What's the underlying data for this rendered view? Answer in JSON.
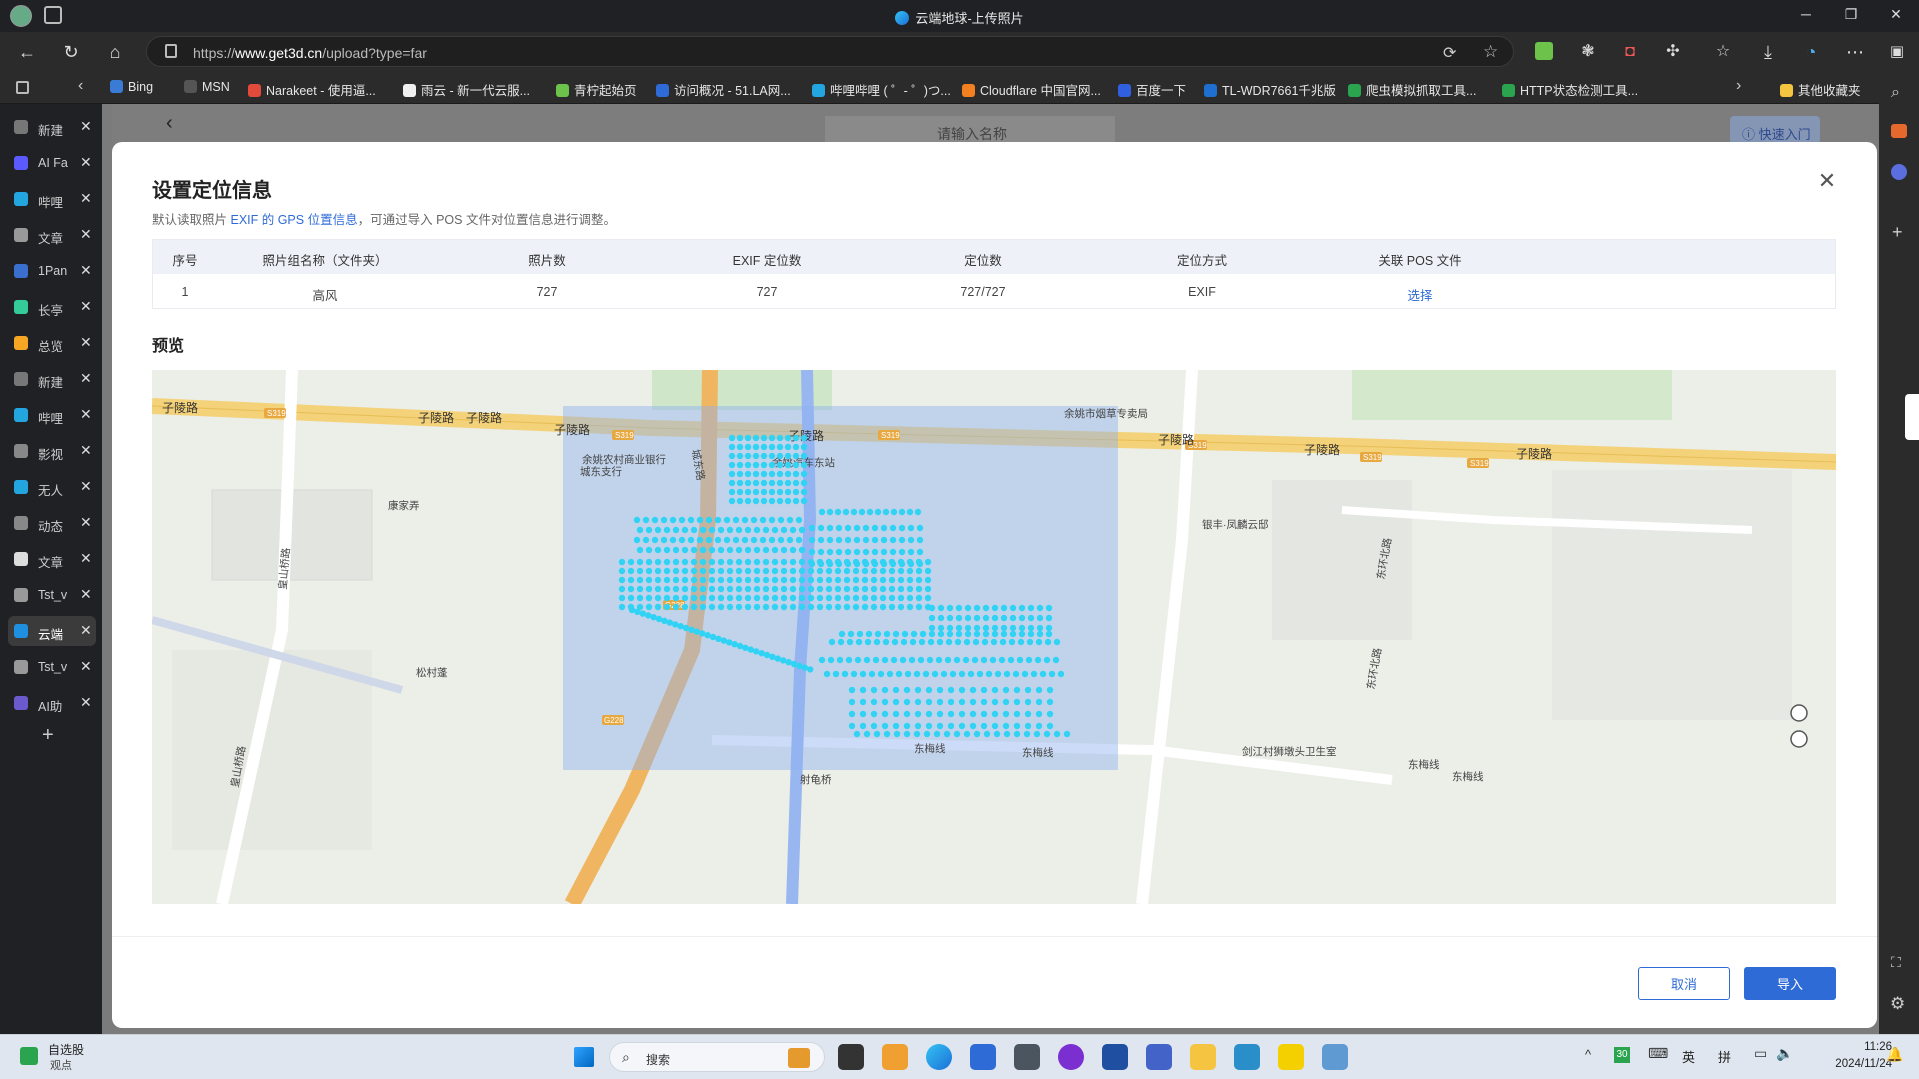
{
  "window": {
    "title": "云端地球-上传照片"
  },
  "address_bar": {
    "url_prefix": "https://",
    "url_host": "www.get3d.cn",
    "url_path": "/upload?type=far"
  },
  "bookmarks": [
    {
      "label": "Bing",
      "color": "#3a7bd5"
    },
    {
      "label": "MSN",
      "color": "#555"
    },
    {
      "label": "Narakeet - 使用逼...",
      "color": "#e24a3b"
    },
    {
      "label": "雨云 - 新一代云服...",
      "color": "#f0f0f0"
    },
    {
      "label": "青柠起始页",
      "color": "#6cc24a"
    },
    {
      "label": "访问概况 - 51.LA网...",
      "color": "#2f6bd6"
    },
    {
      "label": "哔哩哔哩 ( ゜- ゜)つ...",
      "color": "#23a6e0"
    },
    {
      "label": "Cloudflare 中国官网...",
      "color": "#f38020"
    },
    {
      "label": "百度一下",
      "color": "#3060e0"
    },
    {
      "label": "TL-WDR7661千兆版",
      "color": "#1f6fd0"
    },
    {
      "label": "爬虫模拟抓取工具...",
      "color": "#2aa44f"
    },
    {
      "label": "HTTP状态检测工具...",
      "color": "#2aa44f"
    }
  ],
  "bookmarks_other": "其他收藏夹",
  "vertical_tabs": [
    {
      "label": "新建",
      "color": "#777"
    },
    {
      "label": "AI Fa",
      "color": "#5a5aff"
    },
    {
      "label": "哔哩",
      "color": "#23a6e0"
    },
    {
      "label": "文章",
      "color": "#999"
    },
    {
      "label": "1Pan",
      "color": "#3a6fd0"
    },
    {
      "label": "长亭",
      "color": "#3c9"
    },
    {
      "label": "总览",
      "color": "#f5a623"
    },
    {
      "label": "新建",
      "color": "#777"
    },
    {
      "label": "哔哩",
      "color": "#23a6e0"
    },
    {
      "label": "影视",
      "color": "#888"
    },
    {
      "label": "无人",
      "color": "#23a6e0"
    },
    {
      "label": "动态",
      "color": "#888"
    },
    {
      "label": "文章",
      "color": "#ddd"
    },
    {
      "label": "Tst_v",
      "color": "#999"
    },
    {
      "label": "云端",
      "color": "#1f8fe0",
      "active": true
    },
    {
      "label": "Tst_v",
      "color": "#999"
    },
    {
      "label": "AI助",
      "color": "#6a5acd"
    }
  ],
  "page_behind": {
    "search_placeholder": "请输入名称",
    "quick_entry": "快速入门"
  },
  "modal": {
    "title": "设置定位信息",
    "subtitle_pre": "默认读取照片 ",
    "subtitle_link": "EXIF 的 GPS 位置信息",
    "subtitle_post": "，可通过导入 POS 文件对位置信息进行调整。",
    "table": {
      "headers": [
        "序号",
        "照片组名称（文件夹）",
        "照片数",
        "EXIF 定位数",
        "定位数",
        "定位方式",
        "关联 POS 文件"
      ],
      "rows": [
        [
          "1",
          "高风",
          "727",
          "727",
          "727/727",
          "EXIF",
          "选择"
        ]
      ]
    },
    "preview_label": "预览",
    "map_labels": {
      "road1": "子陵路",
      "road2": "子陵路",
      "road3": "子陵路",
      "road4": "子陵路",
      "road5": "子陵路",
      "road6": "子陵路",
      "road7": "子陵路",
      "road8": "子陵路",
      "s319": "S319",
      "bank": "余姚农村商业银行",
      "bank2": "城东支行",
      "bus": "余姚汽车东站",
      "tobacco": "余姚市烟草专卖局",
      "kangjia": "康家弄",
      "yinfeng": "银丰·凤麟云邸",
      "songcun": "松村蓬",
      "dongmei1": "东梅线",
      "dongmei2": "东梅线",
      "dongmei3": "东梅线",
      "dongmei4": "东梅线",
      "shegui": "射龟桥",
      "clinic": "剑江村狮墩头卫生室",
      "chengdong": "城东路",
      "dongbei": "东环北路",
      "dongbei2": "东环北路",
      "huangshan": "皇山桥路",
      "huangshan2": "皇山桥路",
      "g228": "G228"
    },
    "cancel": "取消",
    "import": "导入"
  },
  "taskbar": {
    "stock_name": "自选股",
    "stock_sub": "观点",
    "search": "搜索",
    "tray_num": "30",
    "ime1": "英",
    "ime2": "拼",
    "time": "11:26",
    "date": "2024/11/24"
  }
}
